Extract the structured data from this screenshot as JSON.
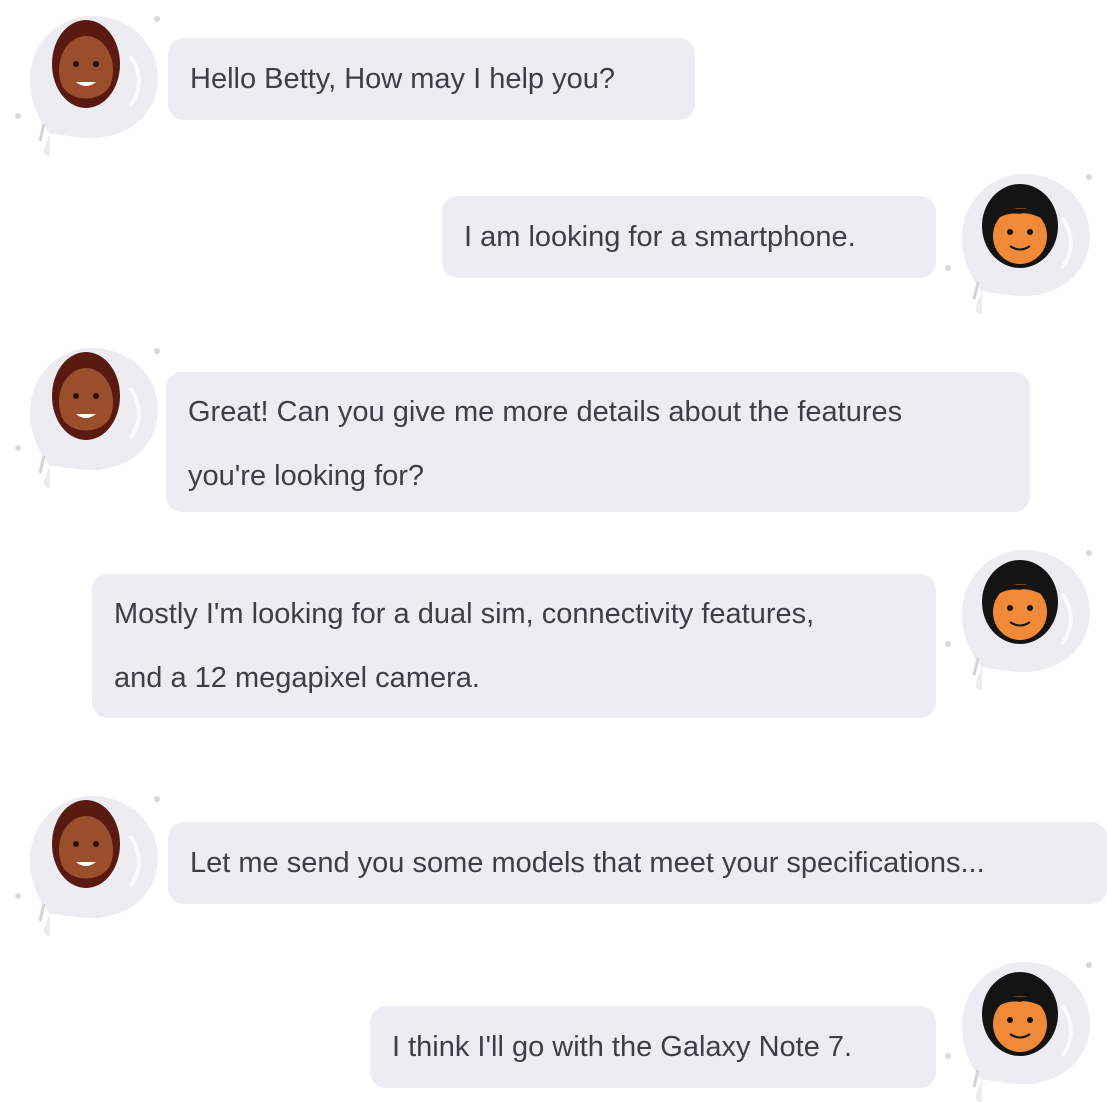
{
  "chat": {
    "messages": [
      {
        "sender": "agent",
        "lines": [
          "Hello Betty, How may I help you?"
        ]
      },
      {
        "sender": "user",
        "lines": [
          "I am looking for a smartphone."
        ]
      },
      {
        "sender": "agent",
        "lines": [
          "Great! Can you give me more details about the features",
          "you're looking for?"
        ]
      },
      {
        "sender": "user",
        "lines": [
          "Mostly I'm looking for a dual sim, connectivity features,",
          "and a 12 megapixel camera."
        ]
      },
      {
        "sender": "agent",
        "lines": [
          "Let me send you some models that meet your specifications..."
        ]
      },
      {
        "sender": "user",
        "lines": [
          "I think I'll go with the Galaxy Note 7."
        ]
      }
    ]
  },
  "colors": {
    "bubble": "#ecedf2",
    "text": "#3e3e48",
    "agent_skin": "#9a4e2c",
    "agent_hair": "#5a1a12",
    "user_skin": "#f08a38",
    "user_hair": "#141414"
  },
  "icons": {
    "agent": "agent-avatar-icon",
    "user": "user-avatar-icon"
  }
}
